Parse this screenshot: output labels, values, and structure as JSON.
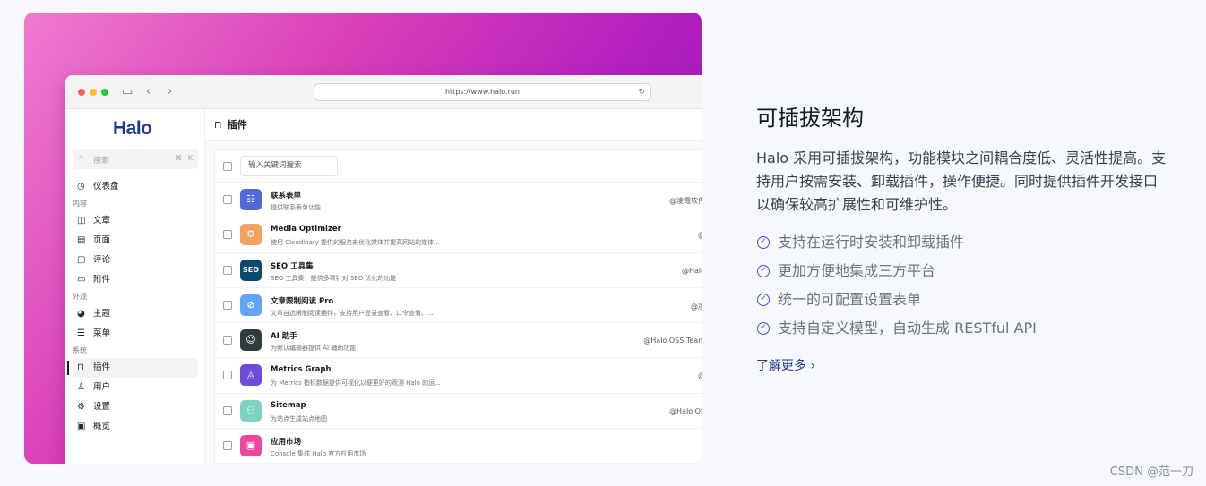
{
  "browser": {
    "url": "https://www.halo.run"
  },
  "sidebar": {
    "logo": "Halo",
    "search_placeholder": "搜索",
    "search_shortcut": "⌘+K",
    "dashboard": "仪表盘",
    "groups": {
      "content": "内容",
      "appearance": "外观",
      "system": "系统"
    },
    "items": {
      "posts": "文章",
      "pages": "页面",
      "comments": "评论",
      "attachments": "附件",
      "themes": "主题",
      "menus": "菜单",
      "plugins": "插件",
      "users": "用户",
      "settings": "设置",
      "overview": "概览"
    }
  },
  "main": {
    "title": "插件",
    "filter_placeholder": "输入关键词搜索",
    "plugins": [
      {
        "name": "联系表单",
        "desc": "提供联系表单功能",
        "author": "@凌霞软件",
        "color": "#4f6bd8",
        "icon": "☷"
      },
      {
        "name": "Media Optimizer",
        "desc": "使用 Cloudinary 提供的服务来优化媒体并提高网站的媒体...",
        "author": "@",
        "color": "#f0a35e",
        "icon": "⚙"
      },
      {
        "name": "SEO 工具集",
        "desc": "SEO 工具集，提供多项针对 SEO 优化的功能",
        "author": "@Halo",
        "color": "#0b4a6f",
        "icon": "SEO"
      },
      {
        "name": "文章限制阅读 Pro",
        "desc": "文章自选限制阅读插件，支持用户登录查看、口令查看、...",
        "author": "@凌",
        "color": "#60a5fa",
        "icon": "⊘"
      },
      {
        "name": "AI 助手",
        "desc": "为默认编辑器提供 AI 辅助功能",
        "author": "@Halo OSS Team",
        "color": "#2f3b3f",
        "icon": "☺"
      },
      {
        "name": "Metrics Graph",
        "desc": "为 Metrics 指标数据提供可视化以便更好的观测 Halo 的运...",
        "author": "@",
        "color": "#6d4cdb",
        "icon": "◬"
      },
      {
        "name": "Sitemap",
        "desc": "为站点生成站点地图",
        "author": "@Halo OS",
        "color": "#7dd3c0",
        "icon": "⚇"
      },
      {
        "name": "应用市场",
        "desc": "Console 集成 Halo 官方应用市场",
        "author": "",
        "color": "#ec4899",
        "icon": "▣"
      }
    ]
  },
  "copy": {
    "title": "可插拔架构",
    "body": "Halo 采用可插拔架构，功能模块之间耦合度低、灵活性提高。支持用户按需安装、卸载插件，操作便捷。同时提供插件开发接口以确保较高扩展性和可维护性。",
    "features": [
      "支持在运行时安装和卸载插件",
      "更加方便地集成三方平台",
      "统一的可配置设置表单",
      "支持自定义模型，自动生成 RESTful API"
    ],
    "more": "了解更多 ›"
  },
  "watermark": "CSDN @范一刀"
}
